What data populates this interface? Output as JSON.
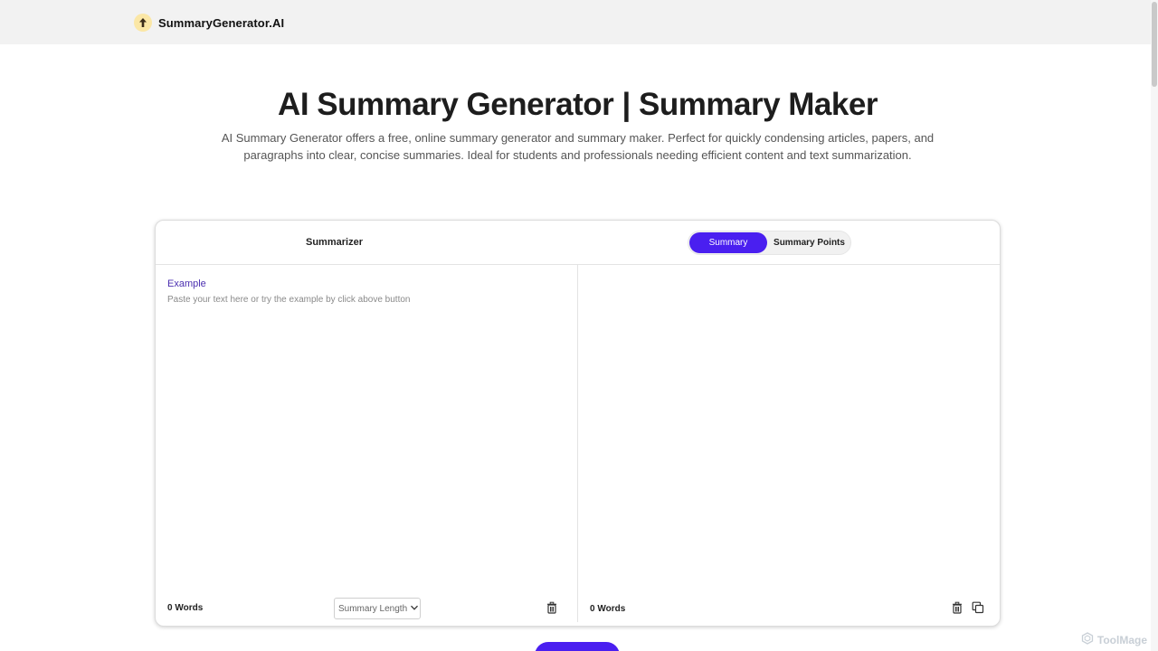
{
  "header": {
    "brand_name": "SummaryGenerator.AI",
    "logo_icon": "upload-arrow-icon"
  },
  "hero": {
    "title": "AI Summary Generator | Summary Maker",
    "description": "AI Summary Generator offers a free, online summary generator and summary maker. Perfect for quickly condensing articles, papers, and paragraphs into clear, concise summaries. Ideal for students and professionals needing efficient content and text summarization."
  },
  "tool": {
    "title": "Summarizer",
    "modes": [
      {
        "label": "Summary",
        "active": true
      },
      {
        "label": "Summary Points",
        "active": false
      }
    ],
    "input": {
      "example_label": "Example",
      "placeholder": "Paste your text here or try the example by click above button",
      "value": ""
    },
    "left_footer": {
      "word_count": "0 Words",
      "length_select_label": "Summary Length"
    },
    "right_footer": {
      "word_count": "0 Words"
    }
  },
  "watermark": {
    "text": "ToolMage"
  },
  "colors": {
    "accent": "#4a1ff0",
    "topbar_bg": "#f2f2f2",
    "example_link": "#4b2fb0"
  }
}
